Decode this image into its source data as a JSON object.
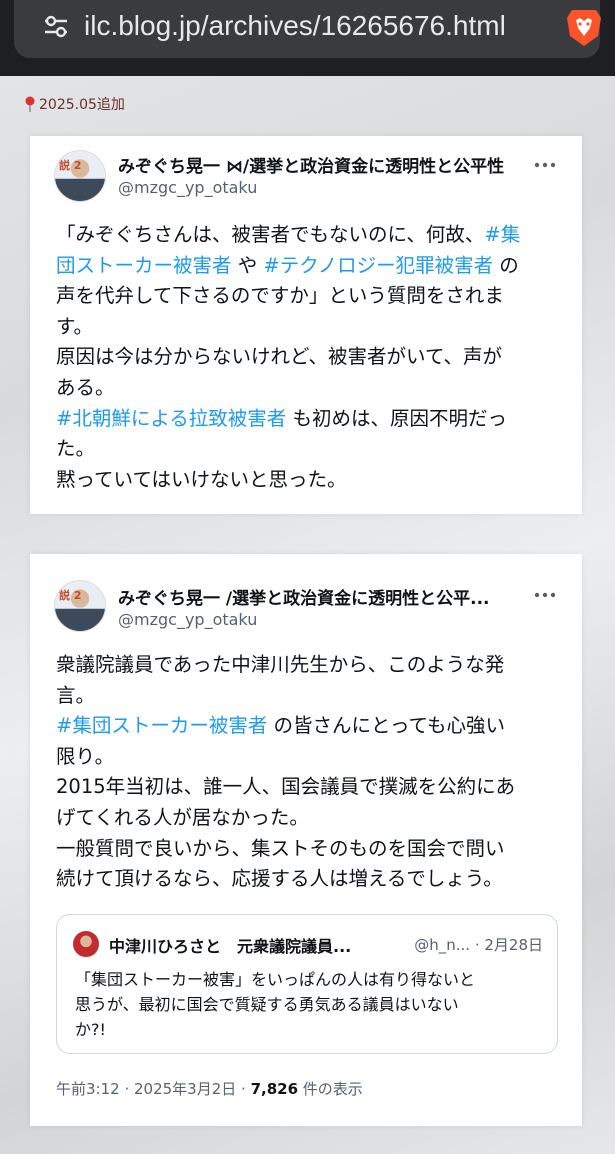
{
  "browser": {
    "url": "ilc.blog.jp/archives/16265676.html",
    "site_settings_icon": "tune-icon",
    "brand_icon": "brave-lion-icon"
  },
  "note": {
    "icon": "pin-icon",
    "text": "2025.05追加"
  },
  "tweets": [
    {
      "avatar_tag": "説 2",
      "author": "みぞぐち晃一 ⋈/選挙と政治資金に透明性と公平性",
      "handle": "@mzgc_yp_otaku",
      "more_icon": "more-horizontal-icon",
      "lines": [
        [
          {
            "t": "「みぞぐちさんは、被害者でもないのに、何故、",
            "h": false
          },
          {
            "t": "#集",
            "h": true
          }
        ],
        [
          {
            "t": "団ストーカー被害者",
            "h": true
          },
          {
            "t": " や ",
            "h": false
          },
          {
            "t": "#テクノロジー犯罪被害者",
            "h": true
          },
          {
            "t": " の",
            "h": false
          }
        ],
        [
          {
            "t": "声を代弁して下さるのですか」という質問をされま",
            "h": false
          }
        ],
        [
          {
            "t": "す。",
            "h": false
          }
        ],
        [
          {
            "t": "原因は今は分からないけれど、被害者がいて、声が",
            "h": false
          }
        ],
        [
          {
            "t": "ある。",
            "h": false
          }
        ],
        [
          {
            "t": "#北朝鮮による拉致被害者",
            "h": true
          },
          {
            "t": " も初めは、原因不明だっ",
            "h": false
          }
        ],
        [
          {
            "t": "た。",
            "h": false
          }
        ],
        [
          {
            "t": "黙っていてはいけないと思った。",
            "h": false
          }
        ]
      ]
    },
    {
      "avatar_tag": "説 2",
      "author": "みぞぐち晃一 /選挙と政治資金に透明性と公平...",
      "handle": "@mzgc_yp_otaku",
      "more_icon": "more-horizontal-icon",
      "lines": [
        [
          {
            "t": "衆議院議員であった中津川先生から、このような発",
            "h": false
          }
        ],
        [
          {
            "t": "言。",
            "h": false
          }
        ],
        [
          {
            "t": "#集団ストーカー被害者",
            "h": true
          },
          {
            "t": " の皆さんにとっても心強い",
            "h": false
          }
        ],
        [
          {
            "t": "限り。",
            "h": false
          }
        ],
        [
          {
            "t": "2015年当初は、誰一人、国会議員で撲滅を公約にあ",
            "h": false
          }
        ],
        [
          {
            "t": "げてくれる人が居なかった。",
            "h": false
          }
        ],
        [
          {
            "t": "一般質問で良いから、集ストそのものを国会で問い",
            "h": false
          }
        ],
        [
          {
            "t": "続けて頂けるなら、応援する人は増えるでしょう。",
            "h": false
          }
        ]
      ],
      "quote": {
        "author": "中津川ひろさと　元衆議院議員...",
        "meta": "@h_n... · 2月28日",
        "lines": [
          "「集団ストーカー被害」をいっぱんの人は有り得ないと",
          "思うが、最初に国会で質疑する勇気ある議員はいない",
          "か?!"
        ]
      },
      "meta": {
        "time": "午前3:12 · 2025年3月2日 · ",
        "views": "7,826",
        "views_suffix": " 件の表示"
      }
    }
  ],
  "colors": {
    "hashtag": "#1d9bf0",
    "text": "#0f1419",
    "secondary": "#536471",
    "brave_orange": "#fb542b"
  }
}
